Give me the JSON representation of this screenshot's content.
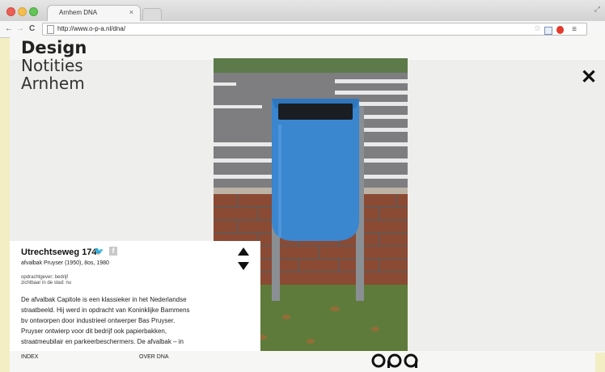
{
  "browser": {
    "tab_title": "Arnhem DNA",
    "tab_close": "×",
    "url": "http://www.o-p-a.nl/dna/",
    "nav_back": "←",
    "nav_forward": "→",
    "nav_reload": "C",
    "bookmark_star": "☆",
    "menu": "≡"
  },
  "site": {
    "title_1": "Design",
    "title_2": "Notities",
    "title_3": "Arnhem",
    "close": "✕"
  },
  "item": {
    "address": "Utrechtseweg 174",
    "twitter": "🐦",
    "facebook": "f",
    "subtitle": "afvalbak Pruyser (1950), 8os, 1980",
    "meta_1": "opdrachtgever: bedrijf",
    "meta_2": "zichtbaar in de stad: nu",
    "description_lines": [
      "De afvalbak Capitole is een klassieker in het Nederlandse",
      "straatbeeld. Hij werd in opdracht van Koninklijke Bammens",
      "bv ontworpen door industrieel ontwerper Bas Pruyser.",
      "Pruyser ontwierp voor dit bedrijf ook papierbakken,",
      "straatmeubilair en parkeerbeschermers. De afvalbak – in"
    ]
  },
  "footer": {
    "index": "INDEX",
    "over": "OVER DNA"
  },
  "colors": {
    "background": "#f3eec4",
    "bin_blue": "#3a86cf"
  }
}
